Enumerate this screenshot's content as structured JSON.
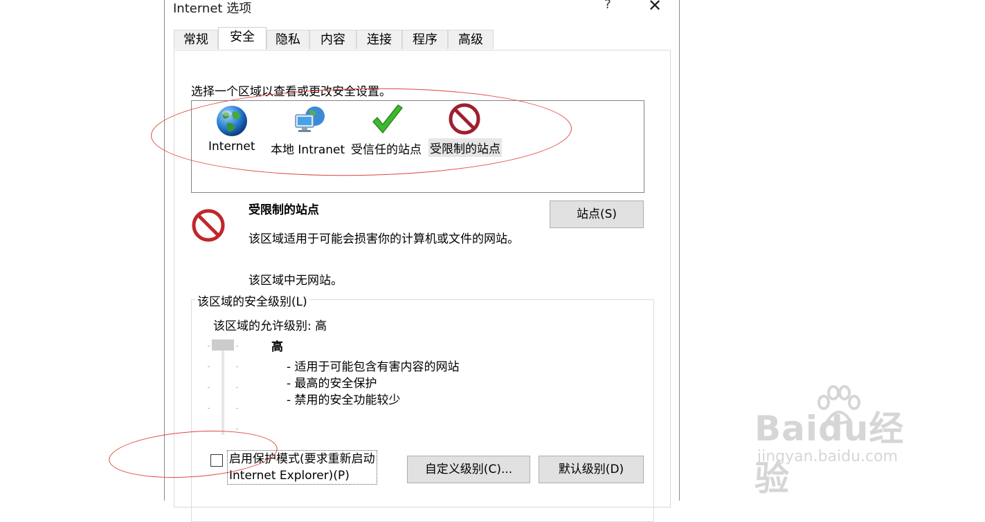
{
  "window": {
    "title": "Internet 选项",
    "help_glyph": "?",
    "close_glyph": "✕"
  },
  "tabs": [
    {
      "label": "常规",
      "active": false
    },
    {
      "label": "安全",
      "active": true
    },
    {
      "label": "隐私",
      "active": false
    },
    {
      "label": "内容",
      "active": false
    },
    {
      "label": "连接",
      "active": false
    },
    {
      "label": "程序",
      "active": false
    },
    {
      "label": "高级",
      "active": false
    }
  ],
  "security": {
    "prompt": "选择一个区域以查看或更改安全设置。",
    "zones": [
      {
        "label": "Internet",
        "icon": "globe-icon",
        "selected": false
      },
      {
        "label": "本地 Intranet",
        "icon": "computer-network-icon",
        "selected": false
      },
      {
        "label": "受信任的站点",
        "icon": "checkmark-icon",
        "selected": false
      },
      {
        "label": "受限制的站点",
        "icon": "restricted-icon",
        "selected": true
      }
    ],
    "selected_zone": {
      "title": "受限制的站点",
      "description": "该区域适用于可能会损害你的计算机或文件的网站。",
      "no_sites": "该区域中无网站。",
      "sites_button": "站点(S)"
    },
    "level_group": {
      "label": "该区域的安全级别(L)",
      "allowed": "该区域的允许级别: 高",
      "level_name": "高",
      "level_lines": [
        "- 适用于可能包含有害内容的网站",
        "- 最高的安全保护",
        "- 禁用的安全功能较少"
      ],
      "slider_level_of_5": 5
    },
    "protected_mode": {
      "line1": "启用保护模式(要求重新启动",
      "line2": "Internet Explorer)(P)",
      "checked": false
    },
    "custom_level_button": "自定义级别(C)...",
    "default_level_button": "默认级别(D)"
  },
  "colors": {
    "annotation": "#e0443c",
    "button_bg": "#e1e1e1",
    "restricted": "#b3262d",
    "check": "#3cb831"
  },
  "watermark": {
    "logo": "Baidu经验",
    "url": "jingyan.baidu.com"
  }
}
